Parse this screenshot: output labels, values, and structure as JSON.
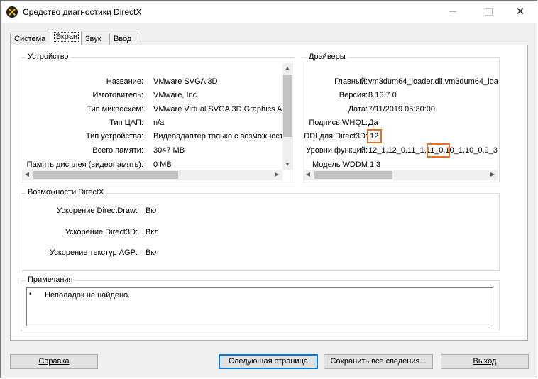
{
  "window": {
    "title": "Средство диагностики DirectX",
    "controls": {
      "minimize": "—",
      "maximize": "☐",
      "close": "✕"
    }
  },
  "tabs": [
    {
      "label": "Система"
    },
    {
      "label": "Экран"
    },
    {
      "label": "Звук"
    },
    {
      "label": "Ввод"
    }
  ],
  "device": {
    "title": "Устройство",
    "rows": [
      {
        "label": "Название:",
        "value": "VMware SVGA 3D"
      },
      {
        "label": "Изготовитель:",
        "value": "VMware, Inc."
      },
      {
        "label": "Тип микросхем:",
        "value": "VMware Virtual SVGA 3D Graphics Ada"
      },
      {
        "label": "Тип ЦАП:",
        "value": "n/a"
      },
      {
        "label": "Тип устройства:",
        "value": "Видеоадаптер только с возможност"
      },
      {
        "label": "Всего памяти:",
        "value": "3047 MB"
      },
      {
        "label": "Память дисплея (видеопамять):",
        "value": "0 MB"
      }
    ]
  },
  "drivers": {
    "title": "Драйверы",
    "rows": [
      {
        "label": "Главный:",
        "value": "vm3dum64_loader.dll,vm3dum64_load"
      },
      {
        "label": "Версия:",
        "value": "8.16.7.0"
      },
      {
        "label": "Дата:",
        "value": "7/11/2019 05:30:00"
      },
      {
        "label": "Подпись WHQL:",
        "value": "Да"
      },
      {
        "label": "DDI для Direct3D:",
        "value": "12"
      },
      {
        "label": "Уровни функций:",
        "value": "12_1,12_0,11_1,11_0,10_1,10_0,9_3"
      },
      {
        "label": "Модель WDDM",
        "value": "1.3"
      }
    ]
  },
  "directx": {
    "title": "Возможности DirectX",
    "rows": [
      {
        "label": "Ускорение DirectDraw:",
        "value": "Вкл"
      },
      {
        "label": "Ускорение Direct3D:",
        "value": "Вкл"
      },
      {
        "label": "Ускорение текстур AGP:",
        "value": "Вкл"
      }
    ]
  },
  "notes": {
    "title": "Примечания",
    "items": [
      "Неполадок не найдено."
    ]
  },
  "buttons": {
    "help": "Справка",
    "next": "Следующая страница",
    "save": "Сохранить все сведения...",
    "exit": "Выход"
  },
  "colors": {
    "highlight": "#e8701e",
    "default_button_border": "#0078d7"
  }
}
